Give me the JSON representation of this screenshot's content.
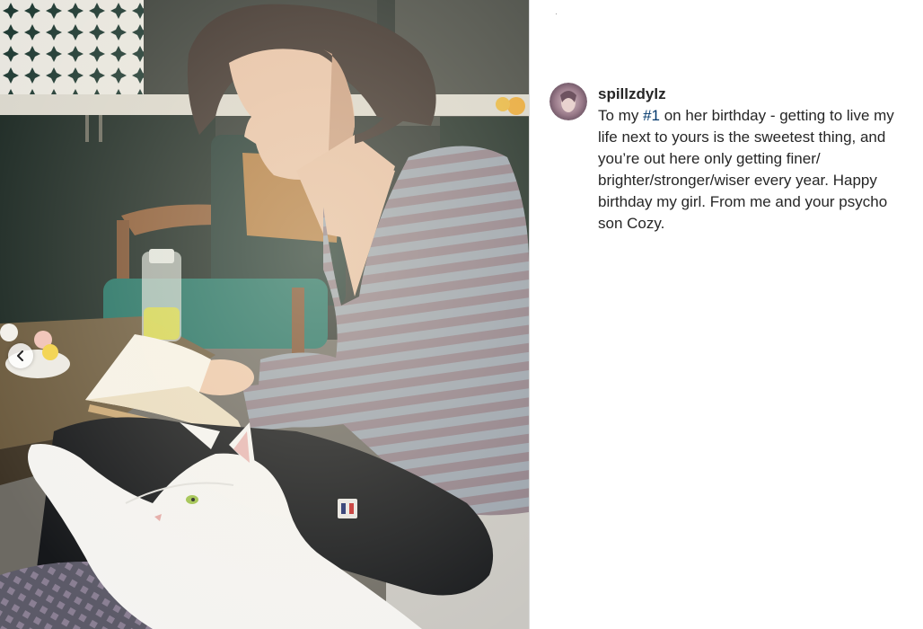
{
  "post": {
    "username": "spillzdylz",
    "caption_before": "To my ",
    "caption_tag": "#1",
    "caption_after": " on her birthday - getting to live my life next to yours is the sweetest thing, and you’re out here only getting finer/ brighter/stronger/wiser every year. Happy birthday my girl. From me and your psycho son Cozy."
  },
  "media": {
    "nav_prev_icon": "chevron-left-icon"
  },
  "colors": {
    "text": "#262626",
    "hashtag": "#00376b",
    "divider": "#dbdbdb"
  }
}
